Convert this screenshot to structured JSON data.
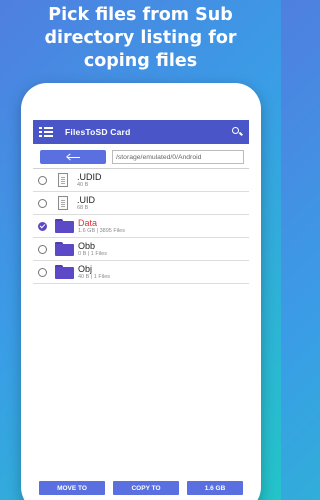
{
  "headline": {
    "line1": "Pick files from Sub",
    "line2": "directory listing for",
    "line3": "coping files"
  },
  "app": {
    "title": "FilesToSD Card",
    "icons": {
      "menu": "menu-icon",
      "search": "search-icon",
      "back": "back-arrow-icon"
    },
    "accent_color": "#4a56c8",
    "button_color": "#5a70e0",
    "folder_color": "#5b49c5",
    "selected_text_color": "#d9333a"
  },
  "path": {
    "current": "/storage/emulated/0/Android"
  },
  "files": [
    {
      "name": ".UDID",
      "meta": "40 B",
      "type": "file",
      "checked": false
    },
    {
      "name": ".UID",
      "meta": "68 B",
      "type": "file",
      "checked": false
    },
    {
      "name": "Data",
      "meta": "1.6 GB | 3895 Files",
      "type": "folder",
      "checked": true
    },
    {
      "name": "Obb",
      "meta": "0 B | 1 Files",
      "type": "folder",
      "checked": false
    },
    {
      "name": "Obj",
      "meta": "40 B | 1 Files",
      "type": "folder",
      "checked": false
    }
  ],
  "bottom": {
    "move_label": "MOVE TO",
    "copy_label": "COPY TO",
    "size_label": "1.6 GB"
  }
}
